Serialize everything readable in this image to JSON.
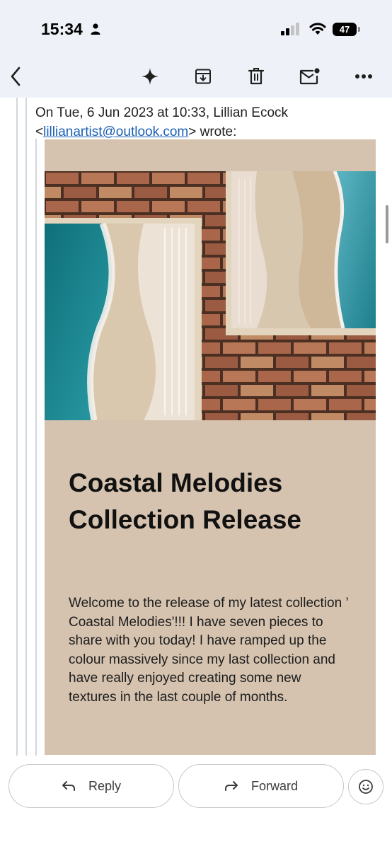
{
  "status_bar": {
    "time": "15:34",
    "battery": "47"
  },
  "toolbar": {
    "icons": [
      "back-icon",
      "sparkle-icon",
      "archive-icon",
      "trash-icon",
      "mark-unread-icon",
      "more-icon"
    ]
  },
  "quoted_message": {
    "intro": "On Tue, 6 Jun 2023 at 10:33, Lillian Ecock",
    "email_open": "<",
    "email": "lillianartist@outlook.com",
    "email_close": "> wrote:"
  },
  "promo": {
    "title_line1": "Coastal Melodies",
    "title_line2": "Collection Release",
    "body": "Welcome to the release of my latest collection ’ Coastal Melodies'!!! I have seven pieces to share with you today! I have ramped up the colour massively since my last collection and have really enjoyed creating some new textures in the last couple of months."
  },
  "actions": {
    "reply_label": "Reply",
    "forward_label": "Forward"
  },
  "colors": {
    "header_bg": "#eef2f8",
    "promo_bg": "#d5c3af",
    "link": "#1a5fb4"
  }
}
